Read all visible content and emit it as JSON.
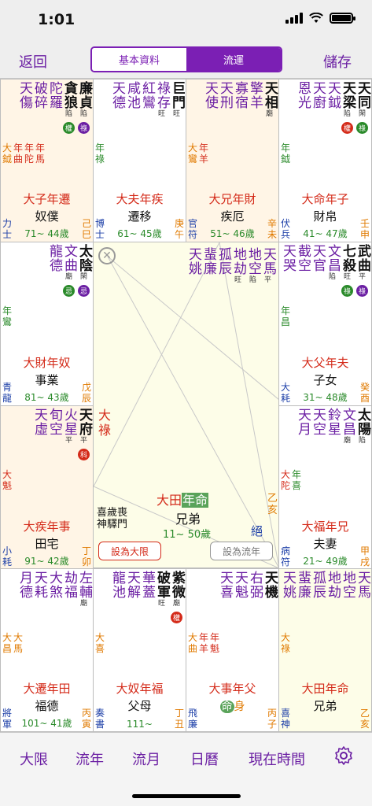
{
  "status": {
    "time": "1:01"
  },
  "nav": {
    "back": "返回",
    "tab_basic": "基本資料",
    "tab_flow": "流運",
    "save": "儲存"
  },
  "cells": {
    "c00": {
      "stars": [
        {
          "t": "廉貞",
          "br": "陷",
          "cls": "dark",
          "major": true,
          "badge": "祿",
          "badge_color": "#6b1fa3"
        },
        {
          "t": "貪狼",
          "br": "陷",
          "cls": "dark",
          "major": true,
          "badge": "權",
          "badge_color": "#2a8a2a"
        },
        {
          "t": "陀羅",
          "br": "",
          "cls": "purple",
          "major": false
        },
        {
          "t": "破碎",
          "br": "",
          "cls": "purple",
          "major": false
        },
        {
          "t": "天傷",
          "br": "",
          "cls": "purple",
          "major": false
        }
      ],
      "minor": [
        [
          "大",
          "鉞"
        ],
        [
          "年",
          "曲"
        ],
        [
          "年",
          "陀"
        ],
        [
          "年",
          "馬"
        ]
      ],
      "minor_cls": [
        "orange",
        "red",
        "red",
        "red"
      ],
      "stage": "大子年遷",
      "palace": "奴僕",
      "cl": [
        "力",
        "士"
      ],
      "cr": [
        "己",
        "巳"
      ],
      "ages": "71~ 44歲"
    },
    "c01": {
      "stars": [
        {
          "t": "巨門",
          "br": "旺",
          "cls": "dark",
          "major": true
        },
        {
          "t": "祿存",
          "br": "旺",
          "cls": "purple",
          "major": false
        },
        {
          "t": "紅鸞",
          "br": "",
          "cls": "purple",
          "major": false
        },
        {
          "t": "咸池",
          "br": "",
          "cls": "purple",
          "major": false
        },
        {
          "t": "天德",
          "br": "",
          "cls": "purple",
          "major": false
        }
      ],
      "minor": [
        [
          "年",
          "祿"
        ]
      ],
      "minor_cls": [
        "green"
      ],
      "stage": "大夫年疾",
      "palace": "遷移",
      "cl": [
        "博",
        "士"
      ],
      "cr": [
        "庚",
        "午"
      ],
      "ages": "61~ 45歲"
    },
    "c02": {
      "stars": [
        {
          "t": "天相",
          "br": "廟",
          "cls": "dark",
          "major": true
        },
        {
          "t": "擎羊",
          "br": "",
          "cls": "purple",
          "major": false
        },
        {
          "t": "寡宿",
          "br": "",
          "cls": "purple",
          "major": false
        },
        {
          "t": "天刑",
          "br": "",
          "cls": "purple",
          "major": false
        },
        {
          "t": "天使",
          "br": "",
          "cls": "purple",
          "major": false
        }
      ],
      "minor": [
        [
          "大",
          "鸞"
        ],
        [
          "年",
          "羊"
        ]
      ],
      "minor_cls": [
        "orange",
        "red"
      ],
      "stage": "大兄年財",
      "palace": "疾厄",
      "cl": [
        "官",
        "符"
      ],
      "cr": [
        "辛",
        "未"
      ],
      "ages": "51~ 46歲"
    },
    "c03": {
      "stars": [
        {
          "t": "天同",
          "br": "閑",
          "cls": "dark",
          "major": true,
          "badge": "祿",
          "badge_color": "#2a8a2a"
        },
        {
          "t": "天梁",
          "br": "陷",
          "cls": "dark",
          "major": true,
          "badge": "權",
          "badge_color": "#d42b1a"
        },
        {
          "t": "天鉞",
          "br": "",
          "cls": "purple",
          "major": false
        },
        {
          "t": "天廚",
          "br": "",
          "cls": "purple",
          "major": false
        },
        {
          "t": "恩光",
          "br": "",
          "cls": "purple",
          "major": false
        }
      ],
      "minor": [
        [
          "年",
          "鉞"
        ]
      ],
      "minor_cls": [
        "green"
      ],
      "stage": "大命年子",
      "palace": "財帛",
      "cl": [
        "伏",
        "兵"
      ],
      "cr": [
        "壬",
        "申"
      ],
      "ages": "41~ 47歲"
    },
    "c10": {
      "stars": [
        {
          "t": "太陰",
          "br": "閑",
          "cls": "dark",
          "major": true,
          "badge": "忌",
          "badge_color": "#6b1fa3"
        },
        {
          "t": "文曲",
          "br": "廟",
          "cls": "purple",
          "major": false,
          "badge": "忌",
          "badge_color": "#2a8a2a"
        },
        {
          "t": "龍德",
          "br": "",
          "cls": "purple",
          "major": false
        }
      ],
      "minor": [
        [
          "年",
          "鸞"
        ]
      ],
      "minor_cls": [
        "green"
      ],
      "stage": "大財年奴",
      "palace": "事業",
      "cl": [
        "青",
        "龍"
      ],
      "cr": [
        "戊",
        "辰"
      ],
      "ages": "81~ 43歲"
    },
    "c13": {
      "stars": [
        {
          "t": "武曲",
          "br": "平",
          "cls": "dark",
          "major": true,
          "badge": "祿",
          "badge_color": "#6b1fa3"
        },
        {
          "t": "七殺",
          "br": "旺",
          "cls": "dark",
          "major": true,
          "badge": "祿",
          "badge_color": "#2a8a2a"
        },
        {
          "t": "文昌",
          "br": "陷",
          "cls": "purple",
          "major": false
        },
        {
          "t": "天官",
          "br": "",
          "cls": "purple",
          "major": false
        },
        {
          "t": "截空",
          "br": "",
          "cls": "purple",
          "major": false
        },
        {
          "t": "天哭",
          "br": "",
          "cls": "purple",
          "major": false
        }
      ],
      "minor": [
        [
          "年",
          "昌"
        ]
      ],
      "minor_cls": [
        "green"
      ],
      "stage": "大父年夫",
      "palace": "子女",
      "cl": [
        "大",
        "耗"
      ],
      "cr": [
        "癸",
        "酉"
      ],
      "ages": "31~ 48歲"
    },
    "c20": {
      "stars": [
        {
          "t": "天府",
          "br": "平",
          "cls": "dark",
          "major": true,
          "badge": "科",
          "badge_color": "#d42b1a"
        },
        {
          "t": "火星",
          "br": "平",
          "cls": "purple",
          "major": false
        },
        {
          "t": "旬空",
          "br": "",
          "cls": "purple",
          "major": false
        },
        {
          "t": "天虛",
          "br": "",
          "cls": "purple",
          "major": false
        }
      ],
      "minor": [
        [
          "大",
          "魁"
        ]
      ],
      "minor_cls": [
        "red"
      ],
      "stage": "大疾年事",
      "palace": "田宅",
      "cl": [
        "小",
        "耗"
      ],
      "cr": [
        "丁",
        "卯"
      ],
      "ages": "91~ 42歲"
    },
    "c23": {
      "stars": [
        {
          "t": "太陽",
          "br": "陷",
          "cls": "dark",
          "major": true
        },
        {
          "t": "文昌",
          "br": "廟",
          "cls": "purple",
          "major": false
        },
        {
          "t": "鈴星",
          "br": "",
          "cls": "purple",
          "major": false
        },
        {
          "t": "天空",
          "br": "",
          "cls": "purple",
          "major": false
        },
        {
          "t": "天月",
          "br": "",
          "cls": "purple",
          "major": false
        }
      ],
      "minor": [
        [
          "大",
          "陀"
        ],
        [
          "年",
          "喜"
        ]
      ],
      "minor_cls": [
        "red",
        "green"
      ],
      "stage": "大福年兄",
      "palace": "夫妻",
      "cl": [
        "病",
        "符"
      ],
      "cr": [
        "甲",
        "戌"
      ],
      "ages": "21~ 49歲"
    },
    "c30": {
      "stars": [
        {
          "t": "左輔",
          "br": "廟",
          "cls": "purple",
          "major": false
        },
        {
          "t": "劫福",
          "br": "",
          "cls": "purple",
          "major": false
        },
        {
          "t": "大煞",
          "br": "",
          "cls": "purple",
          "major": false
        },
        {
          "t": "天耗",
          "br": "",
          "cls": "purple",
          "major": false
        },
        {
          "t": "月德",
          "br": "",
          "cls": "purple",
          "major": false
        }
      ],
      "minor": [
        [
          "大",
          "昌"
        ],
        [
          "大",
          "馬"
        ]
      ],
      "minor_cls": [
        "orange",
        "orange"
      ],
      "stage": "大遷年田",
      "palace": "福德",
      "cl": [
        "將",
        "軍"
      ],
      "cr": [
        "丙",
        "寅"
      ],
      "ages": "101~ 41歲"
    },
    "c31": {
      "stars": [
        {
          "t": "紫微",
          "br": "廟",
          "cls": "dark",
          "major": true,
          "badge": "權",
          "badge_color": "#d42b1a"
        },
        {
          "t": "破軍",
          "br": "旺",
          "cls": "dark",
          "major": true
        },
        {
          "t": "華蓋",
          "br": "",
          "cls": "purple",
          "major": false
        },
        {
          "t": "天解",
          "br": "",
          "cls": "purple",
          "major": false
        },
        {
          "t": "龍池",
          "br": "",
          "cls": "purple",
          "major": false
        }
      ],
      "minor": [
        [
          "大",
          "喜"
        ]
      ],
      "minor_cls": [
        "orange"
      ],
      "stage": "大奴年福",
      "palace": "父母",
      "cl": [
        "奏",
        "書"
      ],
      "cr": [
        "丁",
        "丑"
      ],
      "ages": "111~"
    },
    "c32": {
      "stars": [
        {
          "t": "天機",
          "br": "",
          "cls": "dark",
          "major": true
        },
        {
          "t": "右弼",
          "br": "",
          "cls": "purple",
          "major": false
        },
        {
          "t": "天魁",
          "br": "",
          "cls": "purple",
          "major": false
        },
        {
          "t": "天喜",
          "br": "",
          "cls": "purple",
          "major": false
        }
      ],
      "minor": [
        [
          "大",
          "曲"
        ],
        [
          "年",
          "羊"
        ],
        [
          "年",
          "魁"
        ]
      ],
      "minor_cls": [
        "orange",
        "red",
        "red"
      ],
      "stage": "大事年父",
      "palace": "",
      "cl": [
        "飛",
        "廉"
      ],
      "cr": [
        "丙",
        "子"
      ],
      "ages": ""
    },
    "c33": {
      "stars": [
        {
          "t": "天馬",
          "br": "",
          "cls": "purple",
          "major": false
        },
        {
          "t": "地空",
          "br": "",
          "cls": "purple",
          "major": false
        },
        {
          "t": "地劫",
          "br": "",
          "cls": "purple",
          "major": false
        },
        {
          "t": "孤辰",
          "br": "",
          "cls": "purple",
          "major": false
        },
        {
          "t": "蜚廉",
          "br": "",
          "cls": "purple",
          "major": false
        },
        {
          "t": "天姚",
          "br": "",
          "cls": "purple",
          "major": false
        }
      ],
      "minor": [
        [
          "大",
          "祿"
        ]
      ],
      "minor_cls": [
        "orange"
      ],
      "stage": "大田年命",
      "palace": "兄弟",
      "cl": [
        "喜",
        "神"
      ],
      "cr": [
        "乙",
        "亥"
      ],
      "ages": ""
    }
  },
  "center": {
    "stars": [
      {
        "t": "天馬",
        "br": "平"
      },
      {
        "t": "地空",
        "br": "陷"
      },
      {
        "t": "地劫",
        "br": "旺"
      },
      {
        "t": "孤辰",
        "br": ""
      },
      {
        "t": "蜚廉",
        "br": ""
      },
      {
        "t": "天姚",
        "br": ""
      }
    ],
    "da_lu": "大祿",
    "stage_prefix": "大田",
    "stage_hl": "年命",
    "palace": "兄弟",
    "left_small": [
      "喜歲喪",
      "神驛門"
    ],
    "ages": "11~ 50歲",
    "jue": "絕",
    "gan": [
      "乙",
      "亥"
    ],
    "btn_daxian": "設為大限",
    "btn_liunian": "設為流年"
  },
  "c32_ming": "命",
  "c32_shen": "身",
  "tabs": [
    "大限",
    "流年",
    "流月",
    "日曆",
    "現在時間"
  ]
}
